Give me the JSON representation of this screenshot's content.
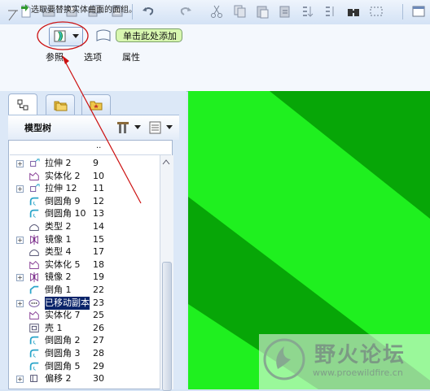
{
  "dashboard": {
    "prompt": "选取要替换实体曲面的面组。",
    "collector_text": "单击此处添加",
    "tabs": [
      "参照",
      "选项",
      "属性"
    ]
  },
  "model_tree": {
    "title": "模型树",
    "column_header": "..",
    "items": [
      {
        "label": "拉伸 2",
        "num": "9",
        "expandable": true,
        "icon": "extrude-icon"
      },
      {
        "label": "实体化 2",
        "num": "10",
        "expandable": false,
        "icon": "solidify-icon"
      },
      {
        "label": "拉伸 12",
        "num": "11",
        "expandable": true,
        "icon": "extrude-icon"
      },
      {
        "label": "倒圆角 9",
        "num": "12",
        "expandable": false,
        "icon": "round-icon"
      },
      {
        "label": "倒圆角 10",
        "num": "13",
        "expandable": false,
        "icon": "round-icon"
      },
      {
        "label": "类型 2",
        "num": "14",
        "expandable": false,
        "icon": "type-icon"
      },
      {
        "label": "镜像 1",
        "num": "15",
        "expandable": true,
        "icon": "mirror-icon"
      },
      {
        "label": "类型 4",
        "num": "17",
        "expandable": false,
        "icon": "type-icon"
      },
      {
        "label": "实体化 5",
        "num": "18",
        "expandable": false,
        "icon": "solidify-icon"
      },
      {
        "label": "镜像 2",
        "num": "19",
        "expandable": true,
        "icon": "mirror-icon"
      },
      {
        "label": "倒角 1",
        "num": "22",
        "expandable": false,
        "icon": "chamfer-icon"
      },
      {
        "label": "已移动副本",
        "num": "23",
        "expandable": true,
        "icon": "moved-copy-icon",
        "selected": true
      },
      {
        "label": "实体化 7",
        "num": "25",
        "expandable": false,
        "icon": "solidify-icon"
      },
      {
        "label": "壳 1",
        "num": "26",
        "expandable": false,
        "icon": "shell-icon"
      },
      {
        "label": "倒圆角 2",
        "num": "27",
        "expandable": false,
        "icon": "round-icon"
      },
      {
        "label": "倒圆角 3",
        "num": "28",
        "expandable": false,
        "icon": "round-icon"
      },
      {
        "label": "倒圆角 5",
        "num": "29",
        "expandable": false,
        "icon": "round-icon"
      },
      {
        "label": "偏移 2",
        "num": "30",
        "expandable": true,
        "icon": "offset-icon"
      }
    ]
  },
  "watermark": {
    "title": "野火论坛",
    "url": "www.proewildfire.cn"
  },
  "colors": {
    "graphics_light": "#1ff01f",
    "graphics_dark": "#07a607",
    "annotation_red": "#cc1111",
    "collector_bg": "#d8f7b0"
  }
}
